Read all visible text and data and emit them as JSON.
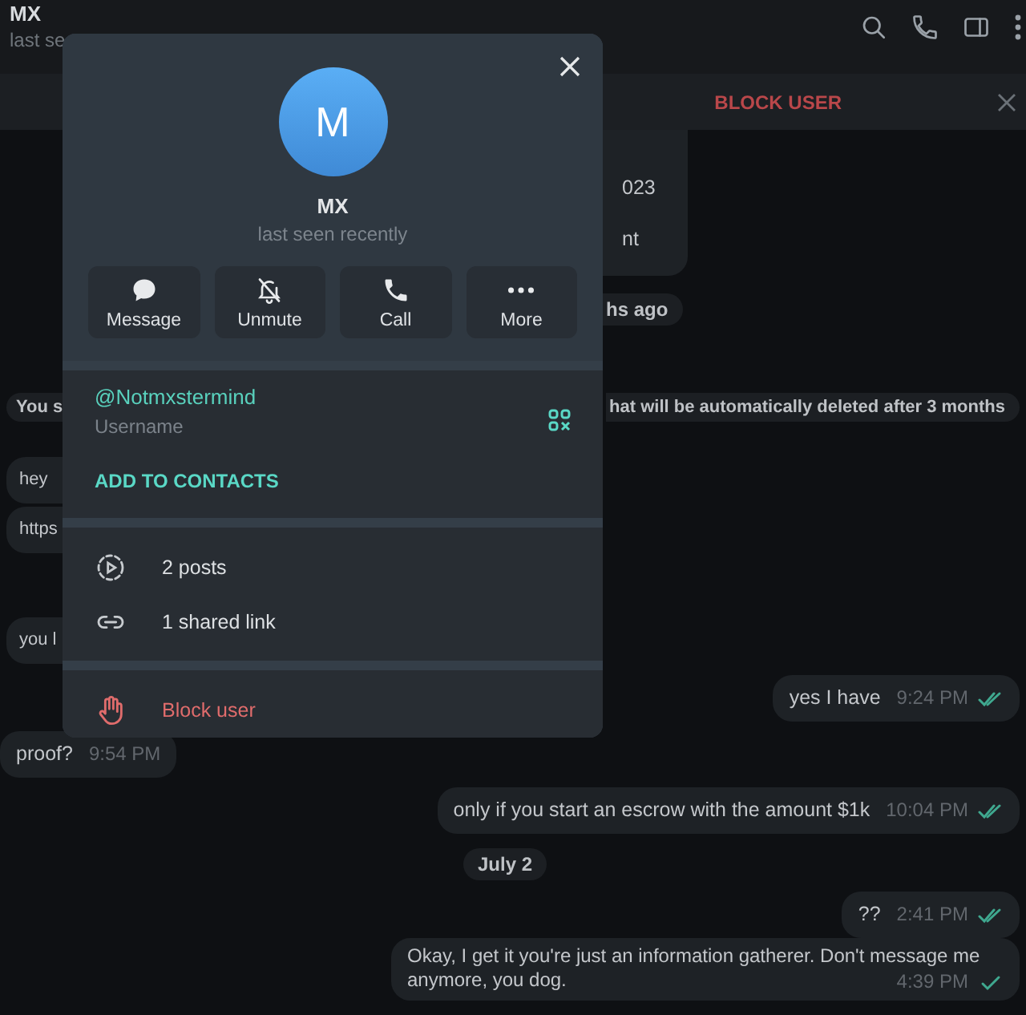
{
  "header": {
    "title": "MX",
    "subtitle": "last se"
  },
  "pinned_bar": {
    "action": "BLOCK USER"
  },
  "messages": [
    {
      "kind": "in_tail",
      "lines": [
        "023",
        "nt"
      ]
    },
    {
      "kind": "service_tail",
      "parts": [
        "hs ago"
      ]
    },
    {
      "kind": "service_split",
      "parts": [
        "You s",
        "hat will be automatically deleted after 3 months"
      ]
    },
    {
      "kind": "in_edge",
      "lines": [
        "hey"
      ]
    },
    {
      "kind": "in_edge",
      "lines": [
        "https"
      ]
    },
    {
      "kind": "in_edge",
      "lines": [
        "you l"
      ]
    },
    {
      "kind": "out",
      "lines": [
        "yes I have"
      ],
      "time": "9:24 PM",
      "read": true
    },
    {
      "kind": "in",
      "lines": [
        "proof?"
      ],
      "time": "9:54 PM"
    },
    {
      "kind": "out",
      "lines": [
        "only if you start an escrow with the amount $1k"
      ],
      "time": "10:04 PM",
      "read": true
    },
    {
      "kind": "date",
      "parts": [
        "July 2"
      ]
    },
    {
      "kind": "out",
      "lines": [
        "??"
      ],
      "time": "2:41 PM",
      "read": true
    },
    {
      "kind": "out",
      "lines": [
        "Okay, I get it you're just an information gatherer. Don't message me anymore, you dog."
      ],
      "time": "4:39 PM",
      "read": false
    }
  ],
  "dialog": {
    "avatar_letter": "M",
    "name": "MX",
    "status": "last seen recently",
    "actions": [
      {
        "kind": "message",
        "label": "Message"
      },
      {
        "kind": "unmute",
        "label": "Unmute"
      },
      {
        "kind": "call",
        "label": "Call"
      },
      {
        "kind": "more",
        "label": "More"
      }
    ],
    "username": "@Notmxstermind",
    "username_label": "Username",
    "add_contact": "ADD TO CONTACTS",
    "media": [
      {
        "kind": "posts",
        "label": "2 posts"
      },
      {
        "kind": "link",
        "label": "1 shared link"
      }
    ],
    "block": "Block user"
  }
}
